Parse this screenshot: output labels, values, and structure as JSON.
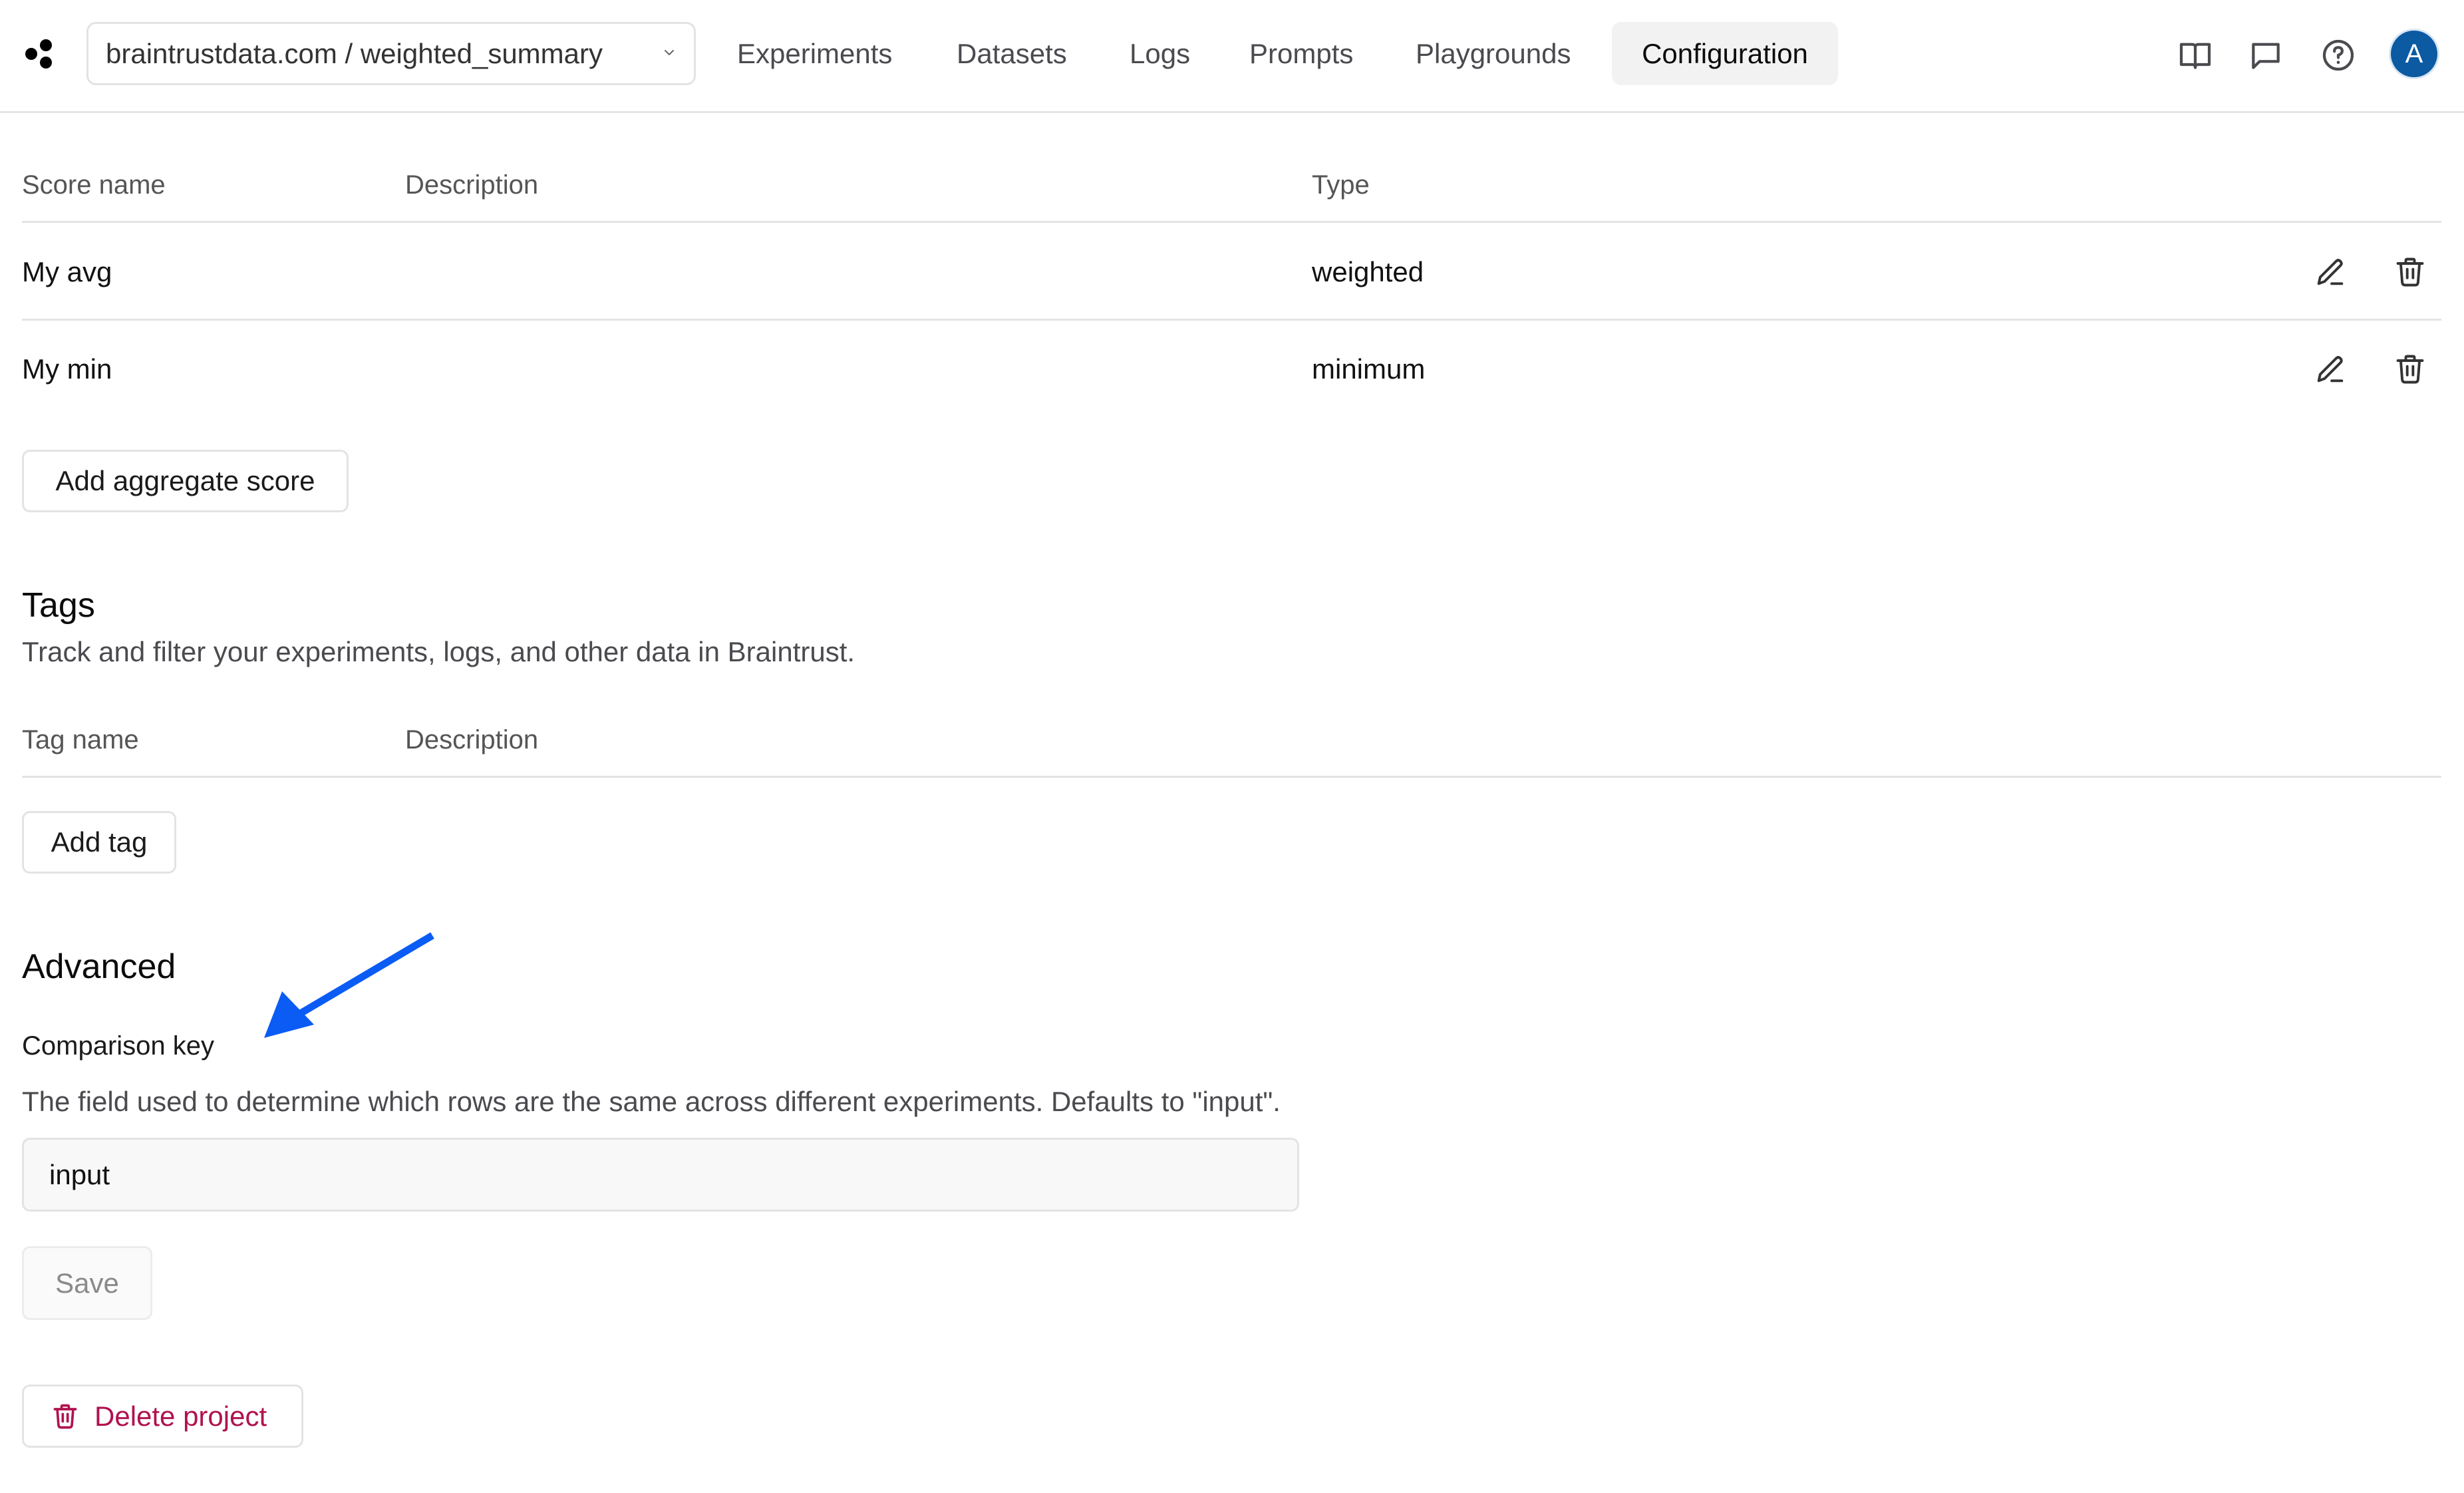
{
  "header": {
    "logo": "braintrust-logo-icon",
    "project_selector": "braintrustdata.com / weighted_summary",
    "tabs": [
      {
        "label": "Experiments",
        "active": false
      },
      {
        "label": "Datasets",
        "active": false
      },
      {
        "label": "Logs",
        "active": false
      },
      {
        "label": "Prompts",
        "active": false
      },
      {
        "label": "Playgrounds",
        "active": false
      },
      {
        "label": "Configuration",
        "active": true
      }
    ],
    "icons": [
      "book-icon",
      "chat-icon",
      "help-icon"
    ],
    "avatar_initial": "A",
    "avatar_color": "#0b5aa2"
  },
  "scores": {
    "columns": [
      "Score name",
      "Description",
      "Type"
    ],
    "rows": [
      {
        "name": "My avg",
        "description": "",
        "type": "weighted"
      },
      {
        "name": "My min",
        "description": "",
        "type": "minimum"
      }
    ],
    "add_button": "Add aggregate score"
  },
  "tags": {
    "title": "Tags",
    "description": "Track and filter your experiments, logs, and other data in Braintrust.",
    "columns": [
      "Tag name",
      "Description"
    ],
    "rows": [],
    "add_button": "Add tag"
  },
  "advanced": {
    "title": "Advanced",
    "comparison_key_label": "Comparison key",
    "comparison_key_description": "The field used to determine which rows are the same across different experiments. Defaults to \"input\".",
    "comparison_key_value": "input",
    "save_button": "Save",
    "save_disabled": true
  },
  "danger": {
    "delete_button": "Delete project",
    "color": "#b0124f"
  },
  "annotation": {
    "arrow_color": "#0a5cf5",
    "points_to": "Comparison key"
  }
}
